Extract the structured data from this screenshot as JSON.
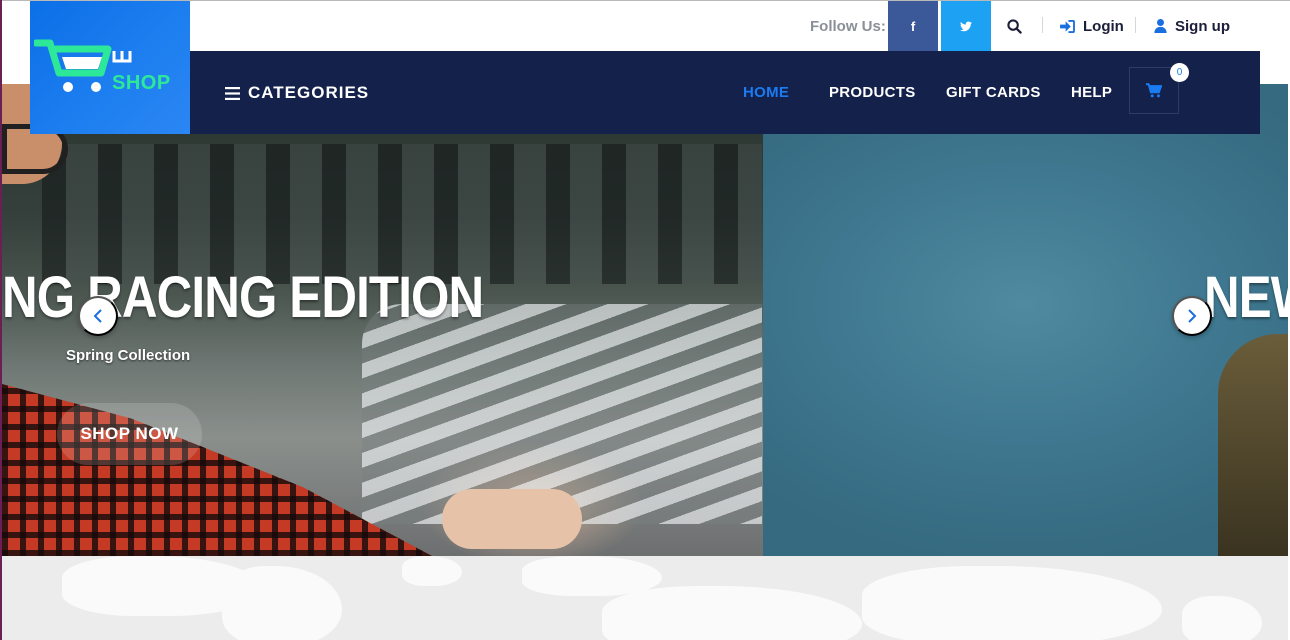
{
  "topbar": {
    "follow_label": "Follow Us:",
    "social": [
      {
        "name": "facebook",
        "glyph": "f",
        "color": "#3b5998"
      },
      {
        "name": "twitter",
        "color": "#1da1f2"
      }
    ],
    "login_label": "Login",
    "signup_label": "Sign up"
  },
  "logo": {
    "text": "SHOP",
    "bg_color": "#1e7ff0",
    "accent_color": "#2ee89a"
  },
  "nav": {
    "categories_label": "CATEGORIES",
    "items": [
      {
        "label": "HOME",
        "active": true
      },
      {
        "label": "PRODUCTS",
        "active": false
      },
      {
        "label": "GIFT CARDS",
        "active": false
      },
      {
        "label": "HELP",
        "active": false
      }
    ],
    "cart_count": "0",
    "bg_color": "#14214a",
    "active_color": "#1a7bf2"
  },
  "hero": {
    "title_left": "NG RACING EDITION",
    "title_right": "NEW",
    "subtitle": "Spring Collection",
    "cta_label": "SHOP NOW"
  },
  "icons": {
    "menu": "hamburger-icon",
    "search": "search-icon",
    "login": "sign-in-icon",
    "signup": "user-icon",
    "cart": "shopping-cart-icon",
    "prev": "chevron-left-icon",
    "next": "chevron-right-icon"
  }
}
